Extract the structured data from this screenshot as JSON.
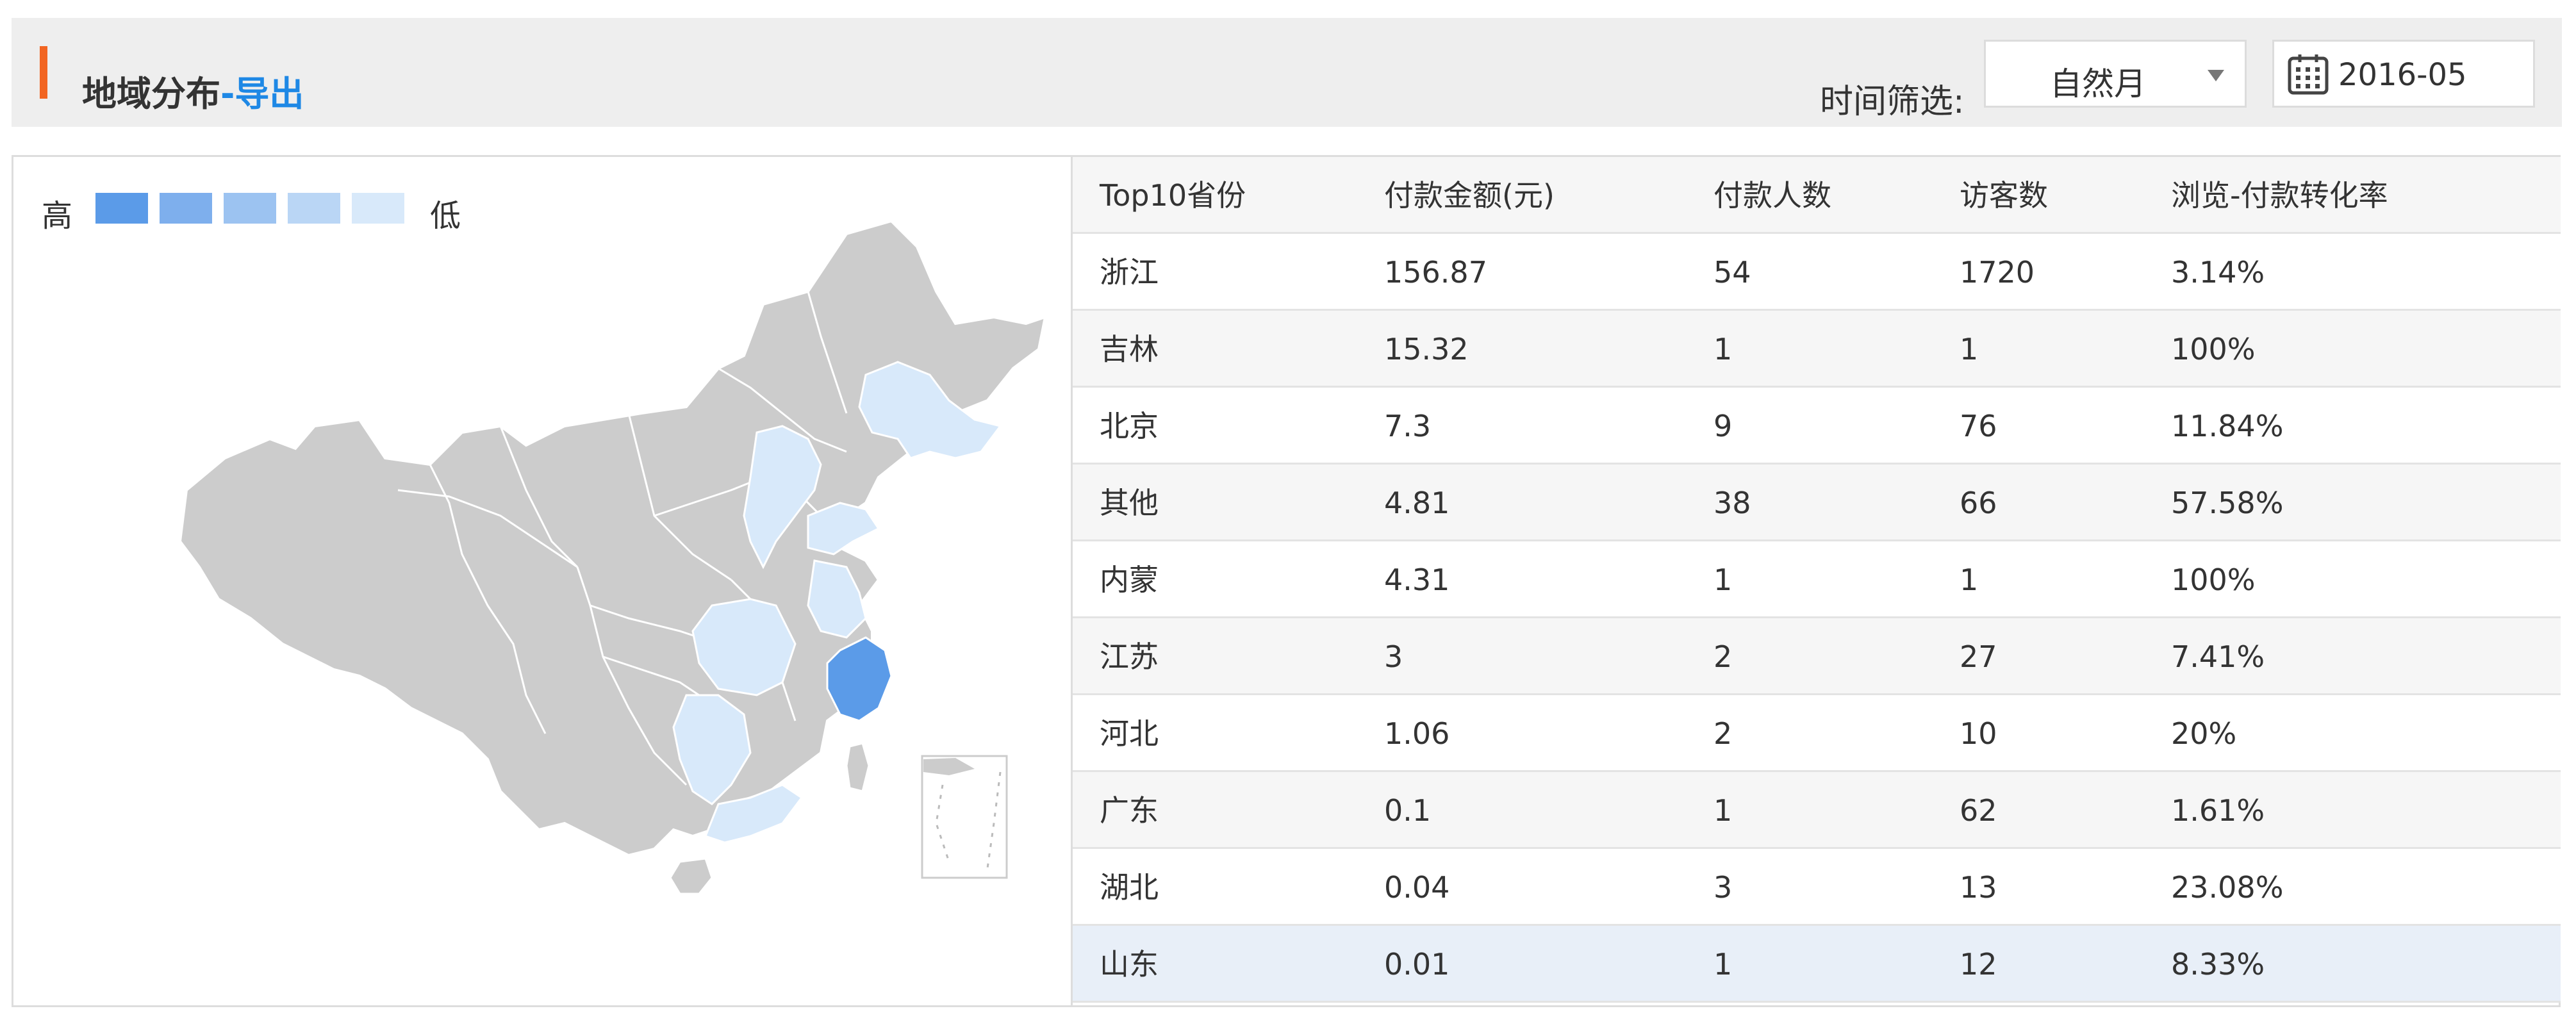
{
  "header": {
    "title": "地域分布",
    "title_link": "-导出",
    "filter_label": "时间筛选:",
    "period_select": "自然月",
    "date_value": "2016-05",
    "accent_color": "#f26522",
    "link_color": "#1e88e5"
  },
  "legend": {
    "high": "高",
    "low": "低",
    "colors": [
      "#5b9be8",
      "#7eafed",
      "#9cc3f1",
      "#bad6f5",
      "#d8e9fa"
    ]
  },
  "map": {
    "base_color": "#cccccc",
    "highlighted_regions": [
      {
        "region": "浙江",
        "color": "#5b9be8"
      },
      {
        "region": "吉林",
        "color": "#d8e9fa"
      },
      {
        "region": "北京",
        "color": "#d8e9fa"
      },
      {
        "region": "内蒙",
        "color": "#d8e9fa"
      },
      {
        "region": "江苏",
        "color": "#d8e9fa"
      },
      {
        "region": "河北",
        "color": "#d8e9fa"
      },
      {
        "region": "广东",
        "color": "#d8e9fa"
      },
      {
        "region": "湖北",
        "color": "#d8e9fa"
      },
      {
        "region": "山东",
        "color": "#d8e9fa"
      }
    ]
  },
  "table": {
    "columns": [
      "Top10省份",
      "付款金额(元)",
      "付款人数",
      "访客数",
      "浏览-付款转化率"
    ],
    "rows": [
      [
        "浙江",
        "156.87",
        "54",
        "1720",
        "3.14%"
      ],
      [
        "吉林",
        "15.32",
        "1",
        "1",
        "100%"
      ],
      [
        "北京",
        "7.3",
        "9",
        "76",
        "11.84%"
      ],
      [
        "其他",
        "4.81",
        "38",
        "66",
        "57.58%"
      ],
      [
        "内蒙",
        "4.31",
        "1",
        "1",
        "100%"
      ],
      [
        "江苏",
        "3",
        "2",
        "27",
        "7.41%"
      ],
      [
        "河北",
        "1.06",
        "2",
        "10",
        "20%"
      ],
      [
        "广东",
        "0.1",
        "1",
        "62",
        "1.61%"
      ],
      [
        "湖北",
        "0.04",
        "3",
        "13",
        "23.08%"
      ],
      [
        "山东",
        "0.01",
        "1",
        "12",
        "8.33%"
      ]
    ],
    "highlighted_row": "山东"
  }
}
